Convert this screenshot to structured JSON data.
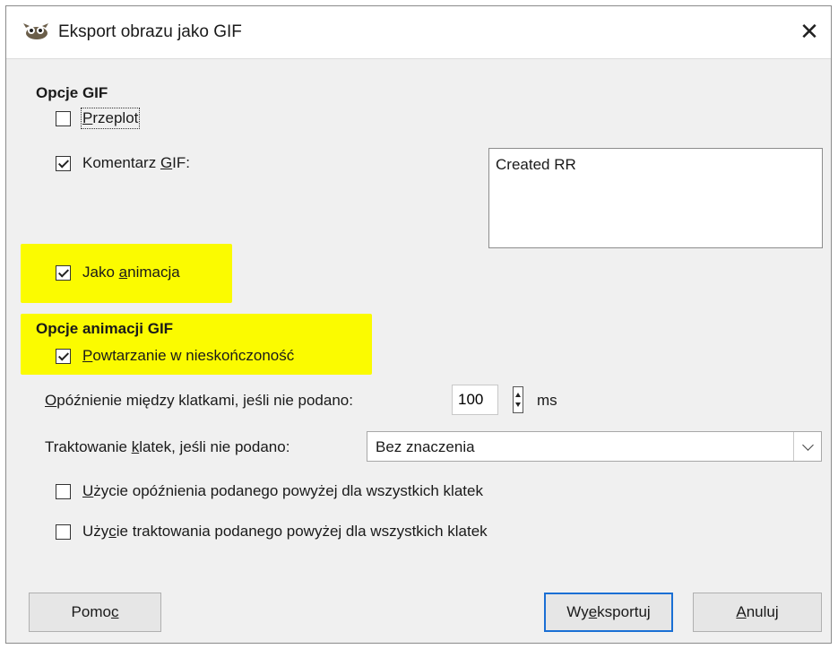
{
  "window": {
    "title": "Eksport obrazu jako GIF",
    "close_symbol": "✕"
  },
  "gif_options": {
    "section_title": "Opcje GIF",
    "interlace": {
      "label_pre": "",
      "label_mnemonic": "P",
      "label_post": "rzeplot",
      "checked": false
    },
    "comment": {
      "label_pre": "Komentarz ",
      "label_mnemonic": "G",
      "label_post": "IF:",
      "checked": true,
      "value": "Created RR"
    },
    "as_animation": {
      "label_pre": "Jako ",
      "label_mnemonic": "a",
      "label_post": "nimacja",
      "checked": true
    }
  },
  "animation_options": {
    "section_title": "Opcje animacji GIF",
    "loop_forever": {
      "label_pre": "",
      "label_mnemonic": "P",
      "label_post": "owtarzanie w nieskończoność",
      "checked": true
    },
    "delay": {
      "label_pre": "",
      "label_mnemonic": "O",
      "label_post": "późnienie między klatkami, jeśli nie podano:",
      "value": "100",
      "unit": "ms"
    },
    "disposal": {
      "label_pre": "Traktowanie ",
      "label_mnemonic": "k",
      "label_post": "latek, jeśli nie podano:",
      "value": "Bez znaczenia"
    },
    "use_delay_all": {
      "label_pre": "",
      "label_mnemonic": "U",
      "label_post": "życie opóźnienia podanego powyżej dla wszystkich klatek",
      "checked": false
    },
    "use_disposal_all": {
      "label_pre": "Uży",
      "label_mnemonic": "c",
      "label_post": "ie traktowania podanego powyżej dla wszystkich klatek",
      "checked": false
    }
  },
  "buttons": {
    "help": {
      "label_pre": "Pomo",
      "label_mnemonic": "c",
      "label_post": ""
    },
    "export": {
      "label_pre": "Wy",
      "label_mnemonic": "e",
      "label_post": "ksportuj"
    },
    "cancel": {
      "label_pre": "",
      "label_mnemonic": "A",
      "label_post": "nuluj"
    }
  },
  "colors": {
    "highlight": "#fbfb00",
    "default_button_border": "#1a6fd4"
  },
  "icons": {
    "app": "gimp-wilber-icon",
    "close": "close-icon",
    "select_arrow": "chevron-down-icon",
    "spinner": "spinner-updown-icon"
  }
}
